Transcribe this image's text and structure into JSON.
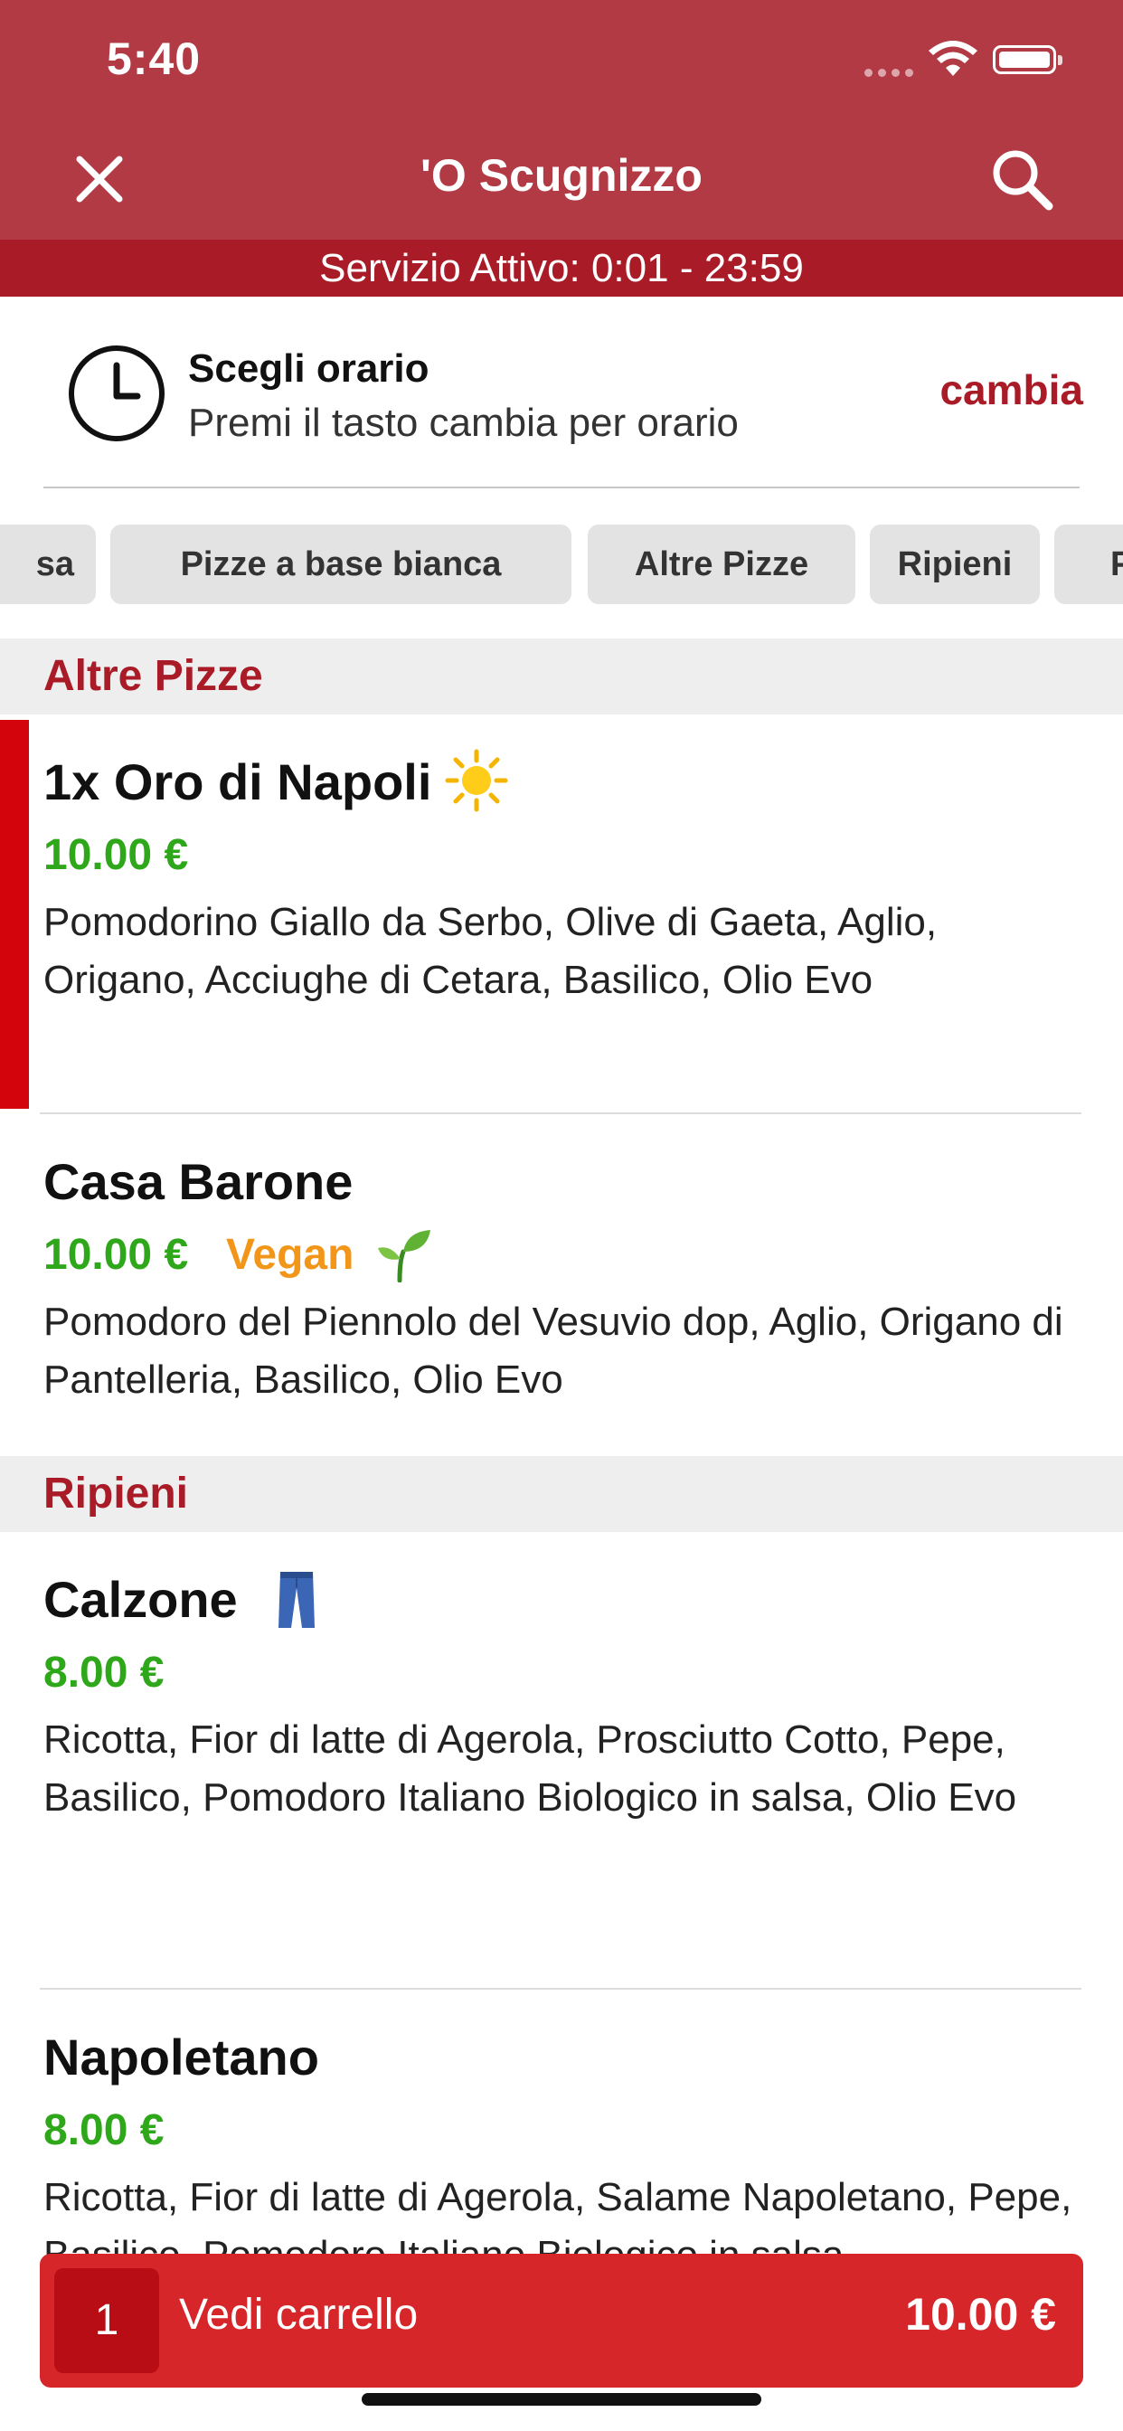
{
  "status_bar": {
    "time": "5:40"
  },
  "header": {
    "title": "'O Scugnizzo"
  },
  "service": {
    "text": "Servizio Attivo: 0:01 - 23:59"
  },
  "time_select": {
    "title": "Scegli orario",
    "subtitle": "Premi il tasto cambia per orario",
    "action": "cambia"
  },
  "tabs": [
    "sa",
    "Pizze a base bianca",
    "Altre Pizze",
    "Ripieni",
    "P"
  ],
  "sections": [
    {
      "title": "Altre Pizze",
      "items": [
        {
          "name": "1x Oro di Napoli",
          "price": "10.00 €",
          "description": "Pomodorino Giallo da Serbo, Olive di Gaeta, Aglio, Origano, Acciughe di Cetara, Basilico, Olio Evo",
          "badge": "sun-icon",
          "selected": true
        },
        {
          "name": "Casa Barone",
          "price": "10.00 €",
          "tag": "Vegan",
          "badge": "seedling-icon",
          "description": "Pomodoro del Piennolo del Vesuvio dop, Aglio, Origano di Pantelleria, Basilico, Olio Evo"
        }
      ]
    },
    {
      "title": "Ripieni",
      "items": [
        {
          "name": "Calzone",
          "price": "8.00 €",
          "badge": "jeans-icon",
          "description": "Ricotta, Fior di latte di Agerola, Prosciutto Cotto, Pepe, Basilico, Pomodoro Italiano Biologico in salsa, Olio Evo"
        },
        {
          "name": "Napoletano",
          "price": "8.00 €",
          "description": "Ricotta, Fior di latte di Agerola, Salame Napoletano, Pepe, Basilico, Pomodoro Italiano Biologico in salsa,"
        }
      ]
    }
  ],
  "cart": {
    "count": "1",
    "label": "Vedi carrello",
    "total": "10.00 €"
  },
  "colors": {
    "header": "#b23a45",
    "service_bar": "#a81b27",
    "accent": "#a81b27",
    "price": "#2fa71a",
    "vegan": "#f2961a",
    "cart": "#d6262a",
    "selected_bar": "#d4040c"
  }
}
